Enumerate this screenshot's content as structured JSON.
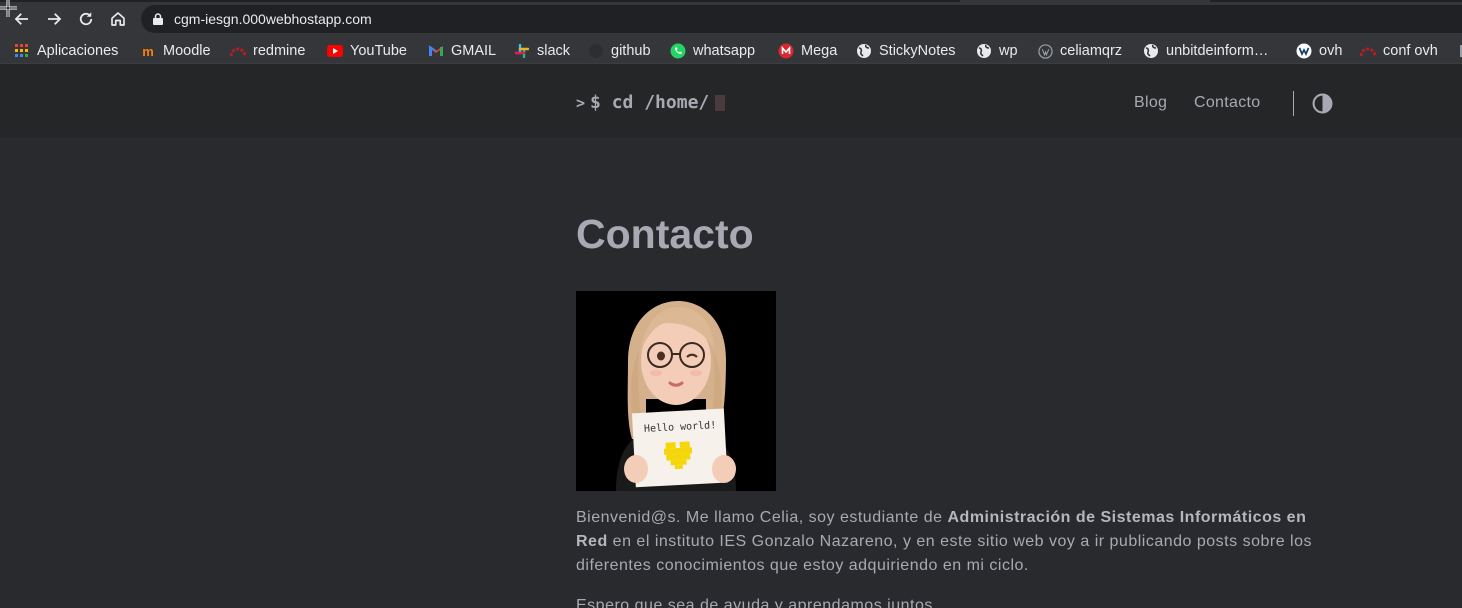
{
  "browser": {
    "url": "cgm-iesgn.000webhostapp.com"
  },
  "bookmarks": [
    {
      "label": "Aplicaciones",
      "icon": "apps-grid-icon"
    },
    {
      "label": "Moodle",
      "icon": "moodle-icon"
    },
    {
      "label": "redmine",
      "icon": "redmine-icon"
    },
    {
      "label": "YouTube",
      "icon": "youtube-icon"
    },
    {
      "label": "GMAIL",
      "icon": "gmail-icon"
    },
    {
      "label": "slack",
      "icon": "slack-icon"
    },
    {
      "label": "github",
      "icon": "github-icon"
    },
    {
      "label": "whatsapp",
      "icon": "whatsapp-icon"
    },
    {
      "label": "Mega",
      "icon": "mega-icon"
    },
    {
      "label": "StickyNotes",
      "icon": "globe-icon"
    },
    {
      "label": "wp",
      "icon": "globe-icon"
    },
    {
      "label": "celiamqrz",
      "icon": "wordpress-icon"
    },
    {
      "label": "unbitdeinform…",
      "icon": "globe-icon"
    },
    {
      "label": "ovh",
      "icon": "ovh-icon"
    },
    {
      "label": "conf ovh",
      "icon": "redmine-icon"
    }
  ],
  "site": {
    "logo_prompt": ">",
    "logo_text": "$ cd /home/",
    "nav": [
      "Blog",
      "Contacto"
    ]
  },
  "page": {
    "title": "Contacto",
    "avatar_caption": "Hello world!",
    "p1_a": "Bienvenid@s. Me llamo Celia, soy estudiante de ",
    "p1_bold": "Administración de Sistemas Informáticos en Red",
    "p1_b": " en el instituto IES Gonzalo Nazareno, y en este sitio web voy a ir publicando posts sobre los diferentes conocimientos que estoy adquiriendo en mi ciclo.",
    "p2": "Espero que sea de ayuda y aprendamos juntos."
  },
  "colors": {
    "background": "#292a2d",
    "header": "#252627",
    "text": "#a9a9b3",
    "browser_chrome": "#35363a"
  }
}
